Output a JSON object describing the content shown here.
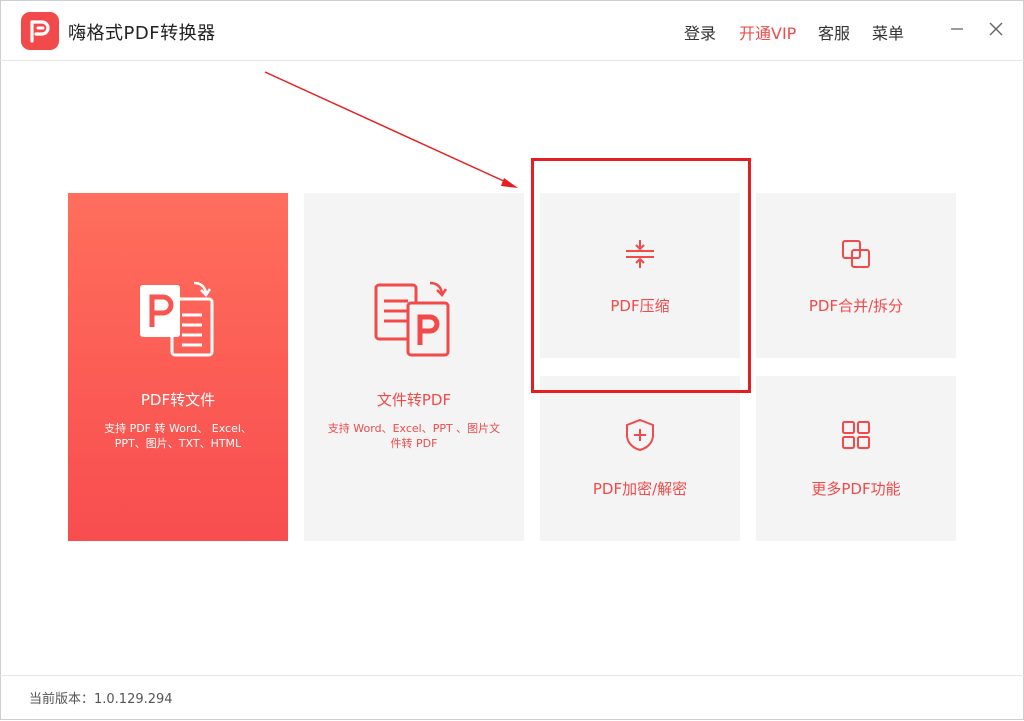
{
  "app": {
    "title": "嗨格式PDF转换器",
    "brand_color": "#f24a4a"
  },
  "header": {
    "login_label": "登录",
    "vip_label": "开通VIP",
    "service_label": "客服",
    "menu_label": "菜单",
    "minimize_icon": "minimize-icon",
    "close_icon": "close-icon"
  },
  "tiles": {
    "pdf_to_file": {
      "title": "PDF转文件",
      "desc": "支持 PDF 转 Word、 Excel、 PPT、图片、TXT、HTML",
      "icon": "pdf-to-file-icon"
    },
    "file_to_pdf": {
      "title": "文件转PDF",
      "desc": "支持 Word、Excel、PPT 、图片文件转 PDF",
      "icon": "file-to-pdf-icon"
    },
    "compress": {
      "title": "PDF压缩",
      "icon": "compress-icon"
    },
    "merge_split": {
      "title": "PDF合并/拆分",
      "icon": "merge-split-icon"
    },
    "encrypt": {
      "title": "PDF加密/解密",
      "icon": "shield-plus-icon"
    },
    "more": {
      "title": "更多PDF功能",
      "icon": "grid-icon"
    }
  },
  "footer": {
    "version": "当前版本：1.0.129.294"
  }
}
